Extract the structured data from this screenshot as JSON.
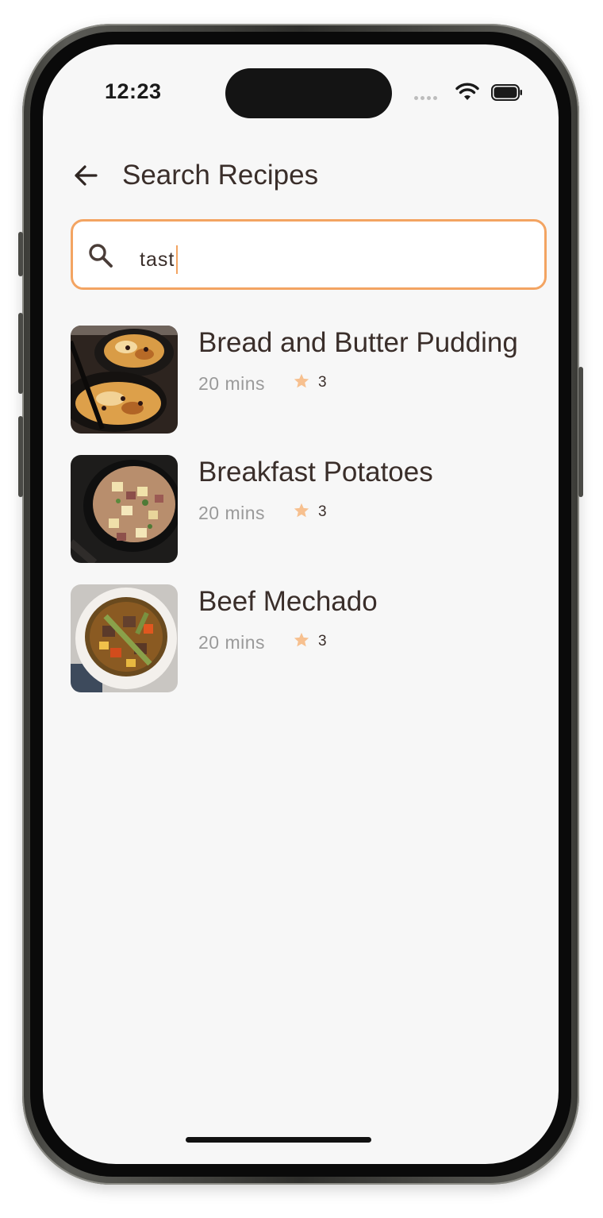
{
  "status_bar": {
    "time": "12:23"
  },
  "header": {
    "title": "Search Recipes"
  },
  "search": {
    "value": "tast"
  },
  "results": [
    {
      "title": "Bread and Butter Pudding",
      "time": "20 mins",
      "rating": "3"
    },
    {
      "title": "Breakfast Potatoes",
      "time": "20 mins",
      "rating": "3"
    },
    {
      "title": "Beef Mechado",
      "time": "20 mins",
      "rating": "3"
    }
  ],
  "colors": {
    "accent": "#f3a462",
    "star": "#f7c08f",
    "text": "#3a2e2a",
    "muted": "#9a9a9a",
    "background": "#f7f7f7"
  },
  "icons": {
    "back": "arrow-left-icon",
    "search": "search-icon",
    "star": "star-icon"
  }
}
